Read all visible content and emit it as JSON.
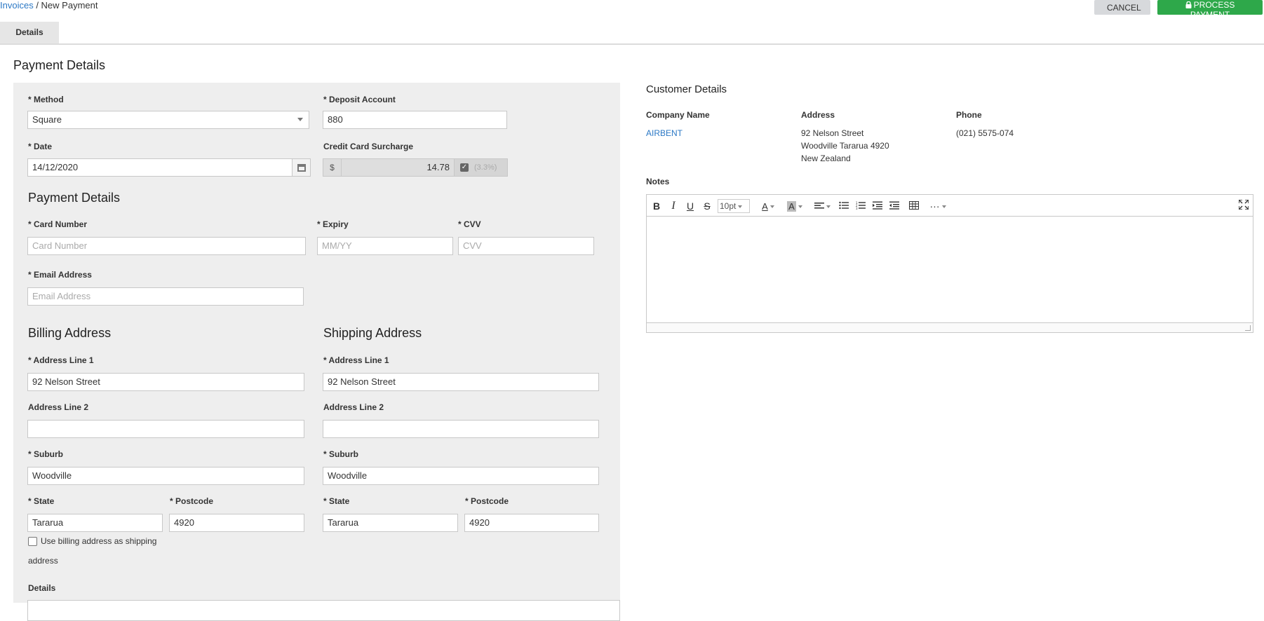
{
  "breadcrumb": {
    "parent": "Invoices",
    "separator": " / ",
    "current": "New Payment"
  },
  "header": {
    "cancel_label": "CANCEL",
    "process_label": "PROCESS PAYMENT"
  },
  "tabs": [
    {
      "label": "Details"
    }
  ],
  "payment": {
    "section_title": "Payment Details",
    "method_label": "* Method",
    "method_value": "Square",
    "deposit_label": "* Deposit Account",
    "deposit_value": "880",
    "date_label": "* Date",
    "date_value": "14/12/2020",
    "surcharge_label": "Credit Card Surcharge",
    "surcharge_prefix": "$",
    "surcharge_value": "14.78",
    "surcharge_pct": "(3.3%)"
  },
  "card": {
    "title": "Payment Details",
    "number_label": "* Card Number",
    "number_placeholder": "Card Number",
    "expiry_label": "* Expiry",
    "expiry_placeholder": "MM/YY",
    "cvv_label": "* CVV",
    "cvv_placeholder": "CVV",
    "email_label": "* Email Address",
    "email_placeholder": "Email Address"
  },
  "billing": {
    "title": "Billing Address",
    "line1_label": "* Address Line 1",
    "line1_value": "92 Nelson Street",
    "line2_label": "Address Line 2",
    "line2_value": "",
    "suburb_label": "* Suburb",
    "suburb_value": "Woodville",
    "state_label": "* State",
    "state_value": "Tararua",
    "postcode_label": "* Postcode",
    "postcode_value": "4920",
    "use_billing_line1": "Use billing address as shipping",
    "use_billing_line2": "address"
  },
  "shipping": {
    "title": "Shipping Address",
    "line1_label": "* Address Line 1",
    "line1_value": "92 Nelson Street",
    "line2_label": "Address Line 2",
    "line2_value": "",
    "suburb_label": "* Suburb",
    "suburb_value": "Woodville",
    "state_label": "* State",
    "state_value": "Tararua",
    "postcode_label": "* Postcode",
    "postcode_value": "4920"
  },
  "details_label": "Details",
  "customer": {
    "title": "Customer Details",
    "company_label": "Company Name",
    "company_value": "AIRBENT",
    "address_label": "Address",
    "address_line1": "92 Nelson Street",
    "address_line2": "Woodville Tararua 4920",
    "address_line3": "New Zealand",
    "phone_label": "Phone",
    "phone_value": "(021) 5575-074"
  },
  "notes": {
    "label": "Notes",
    "toolbar": {
      "bold": "B",
      "italic": "I",
      "underline": "U",
      "strike": "S",
      "font_size": "10pt",
      "font_color": "A",
      "bg_color": "A",
      "more": "···"
    }
  },
  "icons": {
    "lock": "lock-icon",
    "calendar": "calendar-icon",
    "fullscreen": "fullscreen-icon"
  },
  "colors": {
    "link": "#2b78c5",
    "process": "#2ea84a",
    "panel": "#eeeeee"
  }
}
